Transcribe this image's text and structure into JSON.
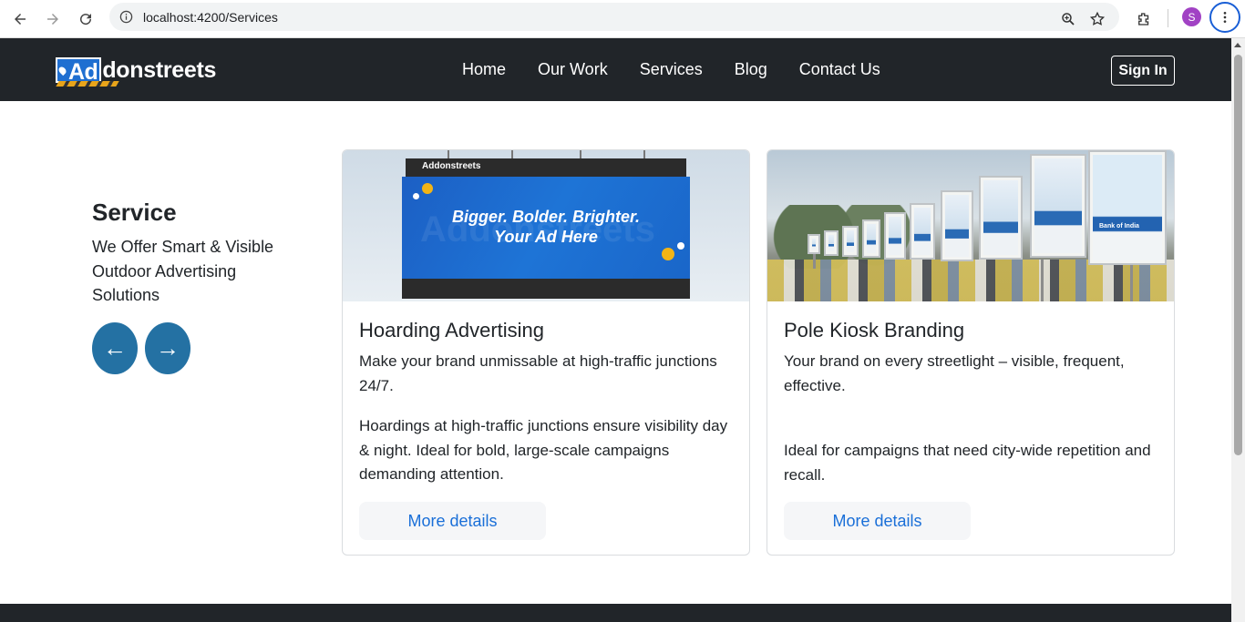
{
  "browser": {
    "url": "localhost:4200/Services",
    "profile_initial": "S",
    "icons": [
      "back-arrow-icon",
      "forward-arrow-icon",
      "reload-icon",
      "site-info-icon",
      "zoom-icon",
      "bookmark-star-icon",
      "extensions-icon",
      "more-vert-icon"
    ]
  },
  "site": {
    "logo": {
      "highlight": "Ad",
      "rest": "donstreets"
    },
    "nav": [
      "Home",
      "Our Work",
      "Services",
      "Blog",
      "Contact Us"
    ],
    "signin_label": "Sign In"
  },
  "intro": {
    "title": "Service",
    "subtitle": "We Offer Smart & Visible Outdoor Advertising Solutions",
    "prev_symbol": "←",
    "next_symbol": "→"
  },
  "cards": [
    {
      "title": "Hoarding Advertising",
      "lead": "Make your brand unmissable at high-traffic junctions 24/7.",
      "detail": "Hoardings at high-traffic junctions ensure visibility day & night. Ideal for bold, large-scale campaigns demanding attention.",
      "button": "More details",
      "image": {
        "brand": "Addonstreets",
        "line1": "Bigger. Bolder. Brighter.",
        "line2": "Your Ad Here"
      }
    },
    {
      "title": "Pole Kiosk Branding",
      "lead": "Your brand on every streetlight – visible, frequent, effective.",
      "detail": "Ideal for campaigns that need city-wide repetition and recall.",
      "button": "More details",
      "image": {
        "brand": "Bank of India"
      }
    }
  ],
  "colors": {
    "navbar": "#212529",
    "accent_button": "#2471a3",
    "link": "#1a6fd8",
    "billboard_blue": "#1e74d6"
  }
}
